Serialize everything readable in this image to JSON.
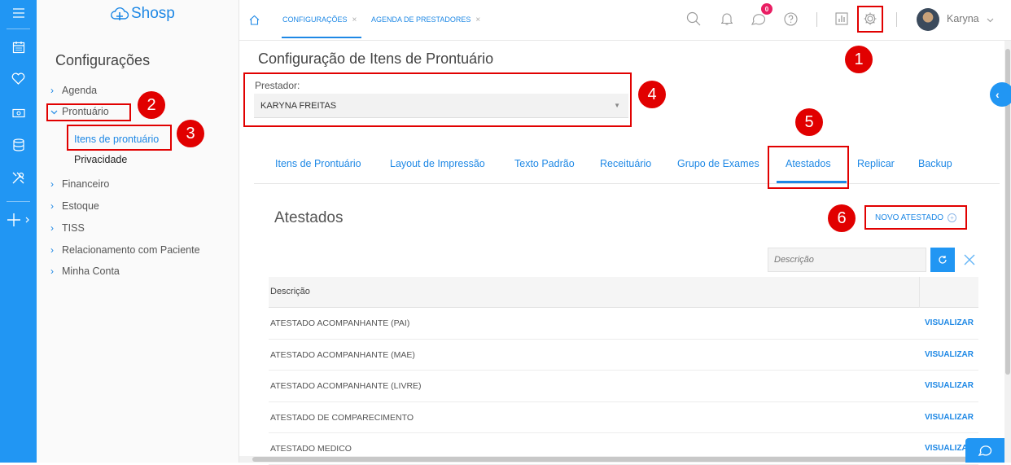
{
  "brand": {
    "name": "Shosp"
  },
  "sidebar": {
    "title": "Configurações",
    "items": [
      {
        "label": "Agenda",
        "expanded": false
      },
      {
        "label": "Prontuário",
        "expanded": true
      },
      {
        "label": "Financeiro",
        "expanded": false
      },
      {
        "label": "Estoque",
        "expanded": false
      },
      {
        "label": "TISS",
        "expanded": false
      },
      {
        "label": "Relacionamento com Paciente",
        "expanded": false
      },
      {
        "label": "Minha Conta",
        "expanded": false
      }
    ],
    "subitems": [
      {
        "label": "Itens de prontuário",
        "active": true
      },
      {
        "label": "Privacidade",
        "active": false
      }
    ]
  },
  "topbar": {
    "tabs": [
      {
        "label": "CONFIGURAÇÕES",
        "active": true
      },
      {
        "label": "AGENDA DE PRESTADORES",
        "active": false
      }
    ],
    "notifications_badge": "0",
    "user": "Karyna",
    "icons": [
      "home-icon",
      "search-icon",
      "bell-icon",
      "chat-icon",
      "help-icon",
      "reports-icon",
      "gear-icon",
      "chevron-down-icon"
    ]
  },
  "main": {
    "title": "Configuração de Itens de Prontuário",
    "prestador_label": "Prestador:",
    "prestador_value": "KARYNA FREITAS",
    "tabs": [
      "Itens de Prontuário",
      "Layout de Impressão",
      "Texto Padrão",
      "Receituário",
      "Grupo de Exames",
      "Atestados",
      "Replicar",
      "Backup"
    ],
    "active_tab": "Atestados",
    "section_title": "Atestados",
    "new_button": "NOVO ATESTADO",
    "search_placeholder": "Descrição",
    "table": {
      "header": "Descrição",
      "action_label": "VISUALIZAR",
      "rows": [
        "ATESTADO ACOMPANHANTE (PAI)",
        "ATESTADO ACOMPANHANTE (MAE)",
        "ATESTADO ACOMPANHANTE (LIVRE)",
        "ATESTADO DE COMPARECIMENTO",
        "ATESTADO MEDICO"
      ]
    }
  },
  "annotations": {
    "steps": [
      "1",
      "2",
      "3",
      "4",
      "5",
      "6"
    ],
    "color": "#e10000"
  },
  "colors": {
    "accent": "#2196f3",
    "link": "#1e88e5",
    "badge": "#e91e63"
  }
}
